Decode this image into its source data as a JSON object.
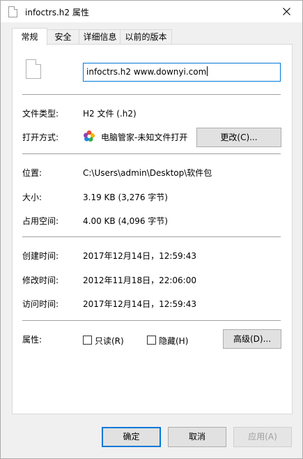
{
  "window": {
    "title": "infoctrs.h2 属性"
  },
  "tabs": [
    "常规",
    "安全",
    "详细信息",
    "以前的版本"
  ],
  "file": {
    "name": "infoctrs.h2 www.downyi.com"
  },
  "fields": {
    "type_label": "文件类型:",
    "type_value": "H2 文件 (.h2)",
    "open_label": "打开方式:",
    "open_value": "电脑管家-未知文件打开",
    "change_button": "更改(C)...",
    "location_label": "位置:",
    "location_value": "C:\\Users\\admin\\Desktop\\软件包",
    "size_label": "大小:",
    "size_value": "3.19 KB (3,276 字节)",
    "disk_label": "占用空间:",
    "disk_value": "4.00 KB (4,096 字节)",
    "created_label": "创建时间:",
    "created_value": "2017年12月14日，12:59:43",
    "modified_label": "修改时间:",
    "modified_value": "2012年11月18日，22:06:00",
    "accessed_label": "访问时间:",
    "accessed_value": "2017年12月14日，12:59:43",
    "attr_label": "属性:",
    "readonly": "只读(R)",
    "hidden": "隐藏(H)",
    "advanced_button": "高级(D)..."
  },
  "footer": {
    "ok": "确定",
    "cancel": "取消",
    "apply": "应用(A)"
  },
  "colors": {
    "accent": "#0078d7",
    "panel": "#ffffff",
    "chrome": "#f0f0f0"
  }
}
